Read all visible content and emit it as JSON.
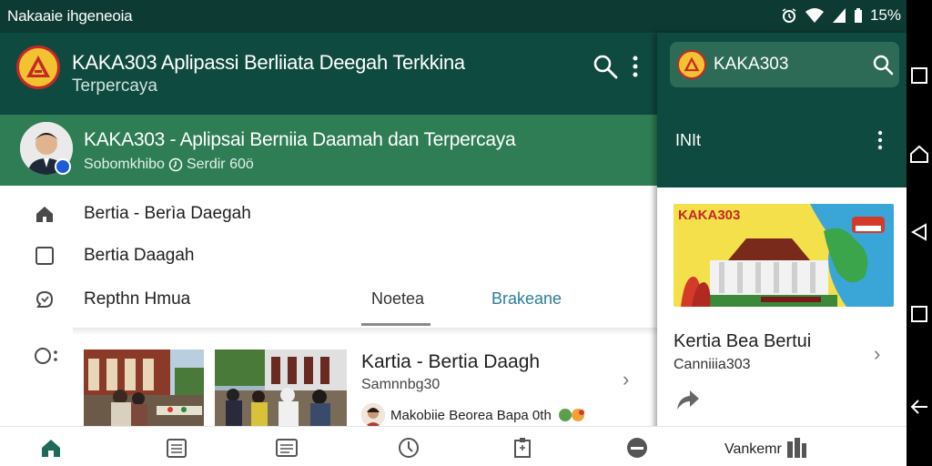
{
  "status_bar": {
    "left_text": "Nakaaie ihgeneoia",
    "battery": "15%",
    "icons": [
      "alarm-icon",
      "wifi-icon",
      "signal-icon",
      "battery-icon"
    ]
  },
  "app_bar": {
    "title": "KAKA303  Aplipassi Berliiata Deegah Terkkina",
    "subtitle": "Terpercaya",
    "icons": [
      "search-icon",
      "more-vert-icon"
    ]
  },
  "channel": {
    "title": "KAKA303 - Aplipsai Berniia Daamah dan Terpercaya",
    "subtitle_left": "Sobomkhibo",
    "subtitle_right": "Serdir 60ö"
  },
  "menu": {
    "items": [
      {
        "label": "Bertia - Berìa Daegah",
        "icon": "home-icon"
      },
      {
        "label": "Bertia Daagah",
        "icon": "square-icon"
      },
      {
        "label": "Repthn Hmua",
        "icon": "chat-icon"
      }
    ]
  },
  "tabs": {
    "news": "Noetea",
    "breaking": "Brakeane"
  },
  "article": {
    "title": "Kartia - Bertia Daagh",
    "date": "Samnnbg30",
    "author": "Makobiie Beorea Bapa 0th"
  },
  "right_panel": {
    "search_name": "KAKA303",
    "section_label": "INIt",
    "banner_text": "KAKA303",
    "card_title": "Kertia Bea Bertui",
    "card_subtitle": "Canniiia303"
  },
  "bottom_nav": {
    "icons": [
      "home-icon",
      "calendar-icon",
      "list-icon",
      "compass-icon",
      "clipboard-icon",
      "minus-circle-icon",
      "book-icon"
    ],
    "label": "Vankemr"
  },
  "colors": {
    "primary_dark": "#0e4a3f",
    "channel_green": "#2e7d55",
    "accent_blue": "#2a7da0",
    "logo_yellow": "#f2c230",
    "logo_red": "#c62828"
  }
}
